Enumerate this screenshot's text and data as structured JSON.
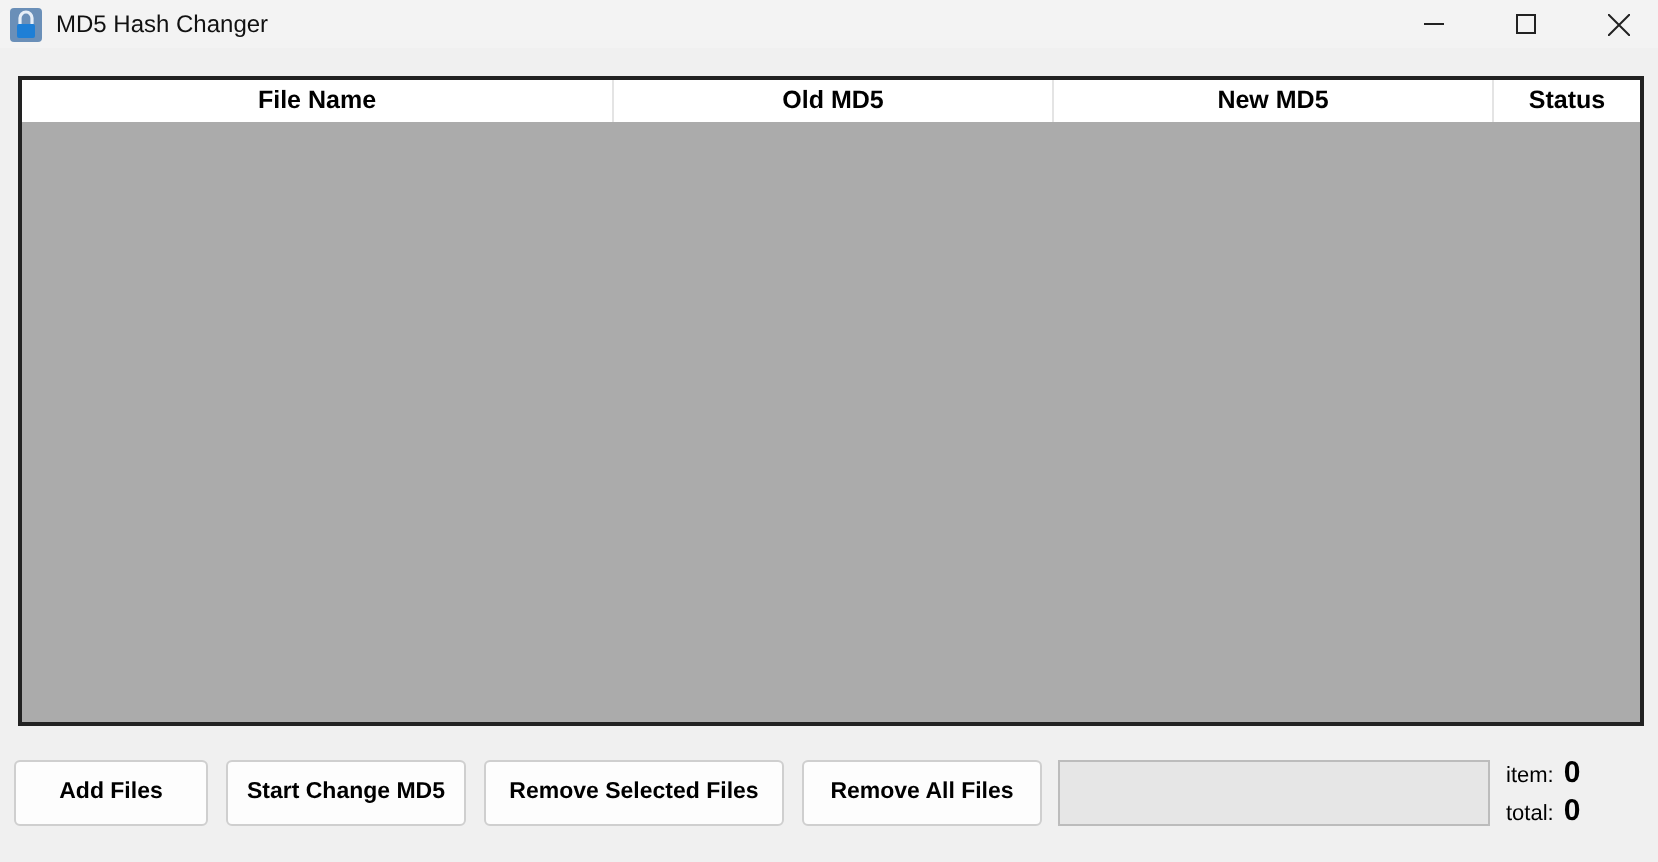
{
  "window": {
    "title": "MD5 Hash Changer"
  },
  "table": {
    "columns": [
      "File Name",
      "Old MD5",
      "New MD5",
      "Status"
    ]
  },
  "buttons": [
    "Add Files",
    "Start Change MD5",
    "Remove Selected Files",
    "Remove All Files"
  ],
  "progress": {
    "level": 0
  },
  "counters": [
    {
      "label": "item:",
      "value": "0"
    },
    {
      "label": "total:",
      "value": "0"
    }
  ]
}
